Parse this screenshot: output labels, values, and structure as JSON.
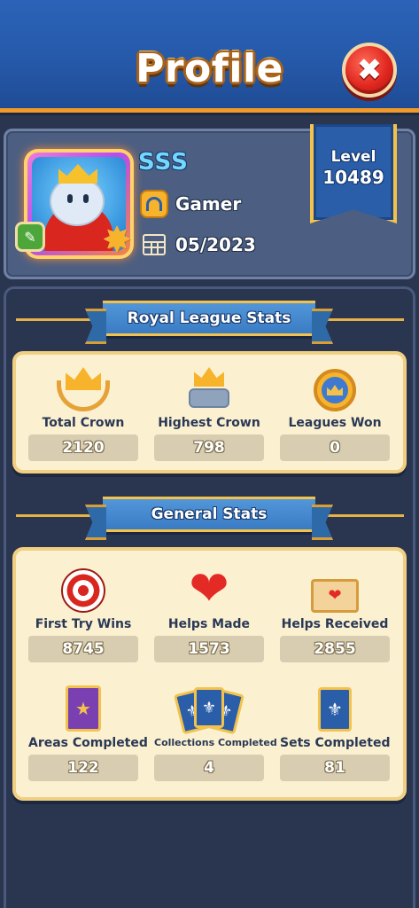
{
  "header": {
    "title": "Profile",
    "close_label": "✖"
  },
  "profile": {
    "username": "SSS",
    "title": "Gamer",
    "joined": "05/2023",
    "level_label": "Level",
    "level_value": "10489"
  },
  "royal_league": {
    "heading": "Royal League Stats",
    "stats": [
      {
        "label": "Total Crown",
        "value": "2120"
      },
      {
        "label": "Highest Crown",
        "value": "798"
      },
      {
        "label": "Leagues Won",
        "value": "0"
      }
    ]
  },
  "general": {
    "heading": "General Stats",
    "stats": [
      {
        "label": "First Try Wins",
        "value": "8745"
      },
      {
        "label": "Helps Made",
        "value": "1573"
      },
      {
        "label": "Helps Received",
        "value": "2855"
      },
      {
        "label": "Areas Completed",
        "value": "122"
      },
      {
        "label": "Collections Completed",
        "value": "4"
      },
      {
        "label": "Sets Completed",
        "value": "81"
      }
    ]
  },
  "colors": {
    "header_blue": "#2c63b8",
    "accent_gold": "#f3c24c",
    "panel_bg": "#2a3550",
    "stat_box": "#fbf1d0"
  },
  "icons": {
    "close": "close-icon",
    "title": "headset-icon",
    "joined": "calendar-icon"
  }
}
